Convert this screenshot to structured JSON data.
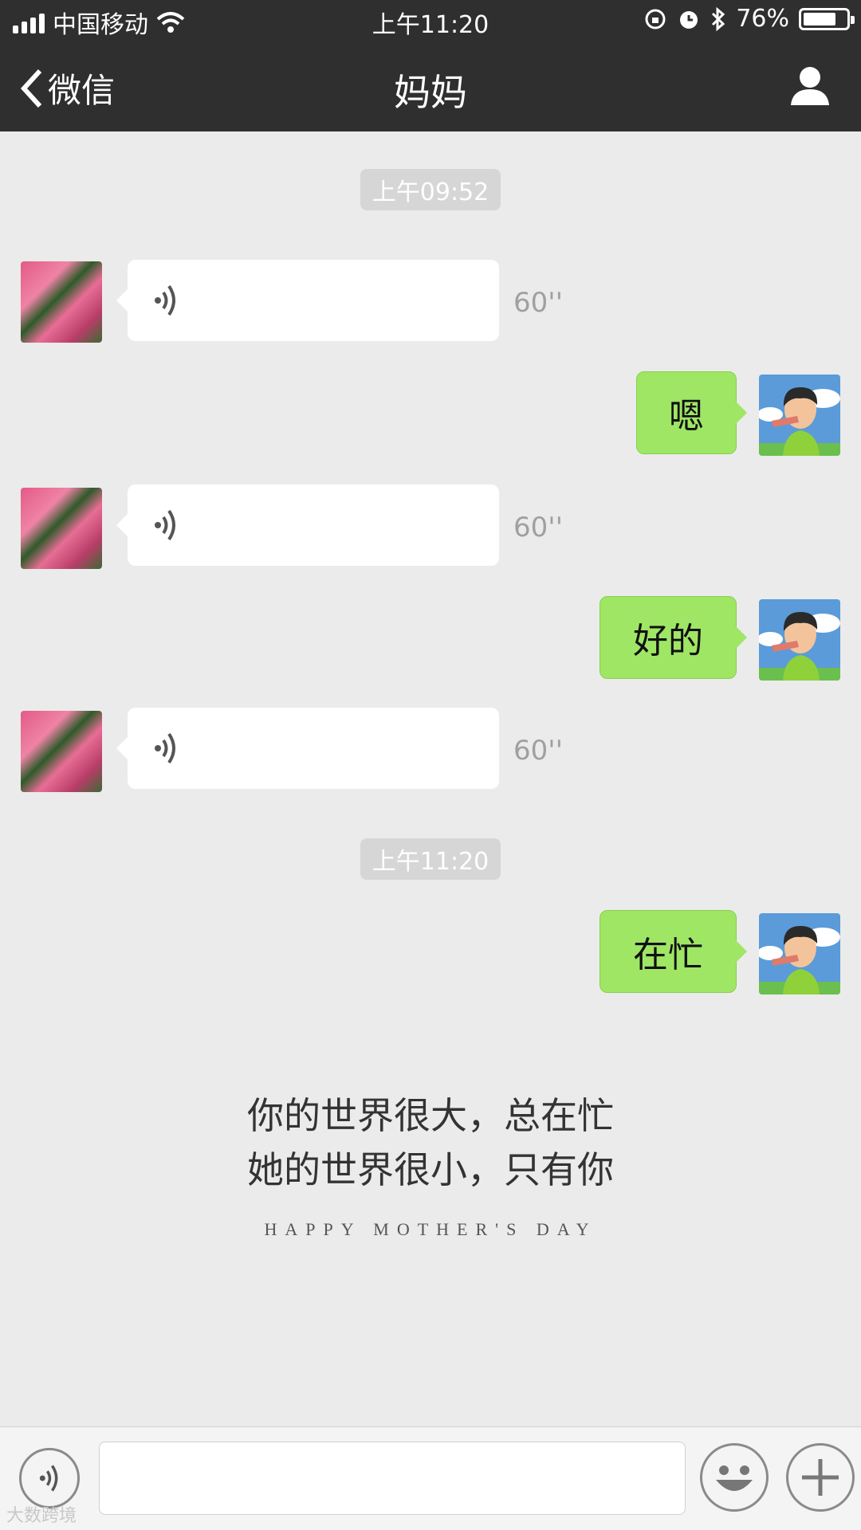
{
  "status_bar": {
    "carrier": "中国移动",
    "time": "上午11:20",
    "battery": "76%",
    "battery_level": 0.76
  },
  "nav": {
    "back_label": "微信",
    "title": "妈妈"
  },
  "chat": {
    "timestamps": [
      "上午09:52",
      "上午11:20"
    ],
    "messages": [
      {
        "from": "mom",
        "type": "voice",
        "duration": "60''"
      },
      {
        "from": "me",
        "type": "text",
        "text": "嗯"
      },
      {
        "from": "mom",
        "type": "voice",
        "duration": "60''"
      },
      {
        "from": "me",
        "type": "text",
        "text": "好的"
      },
      {
        "from": "mom",
        "type": "voice",
        "duration": "60''"
      },
      {
        "from": "me",
        "type": "text",
        "text": "在忙"
      }
    ]
  },
  "overlay": {
    "line1": "你的世界很大，总在忙",
    "line2": "她的世界很小，只有你",
    "motto": "HAPPY MOTHER'S DAY"
  },
  "watermark": "大数跨境",
  "colors": {
    "navbar": "#2f2f2f",
    "chat_bg": "#ebebeb",
    "my_bubble": "#9fe665",
    "voice_bubble": "#ffffff"
  },
  "icons": {
    "back": "chevron-left-icon",
    "profile": "person-icon",
    "voice": "voice-wave-icon",
    "emoji": "smiley-icon",
    "plus": "plus-icon"
  }
}
